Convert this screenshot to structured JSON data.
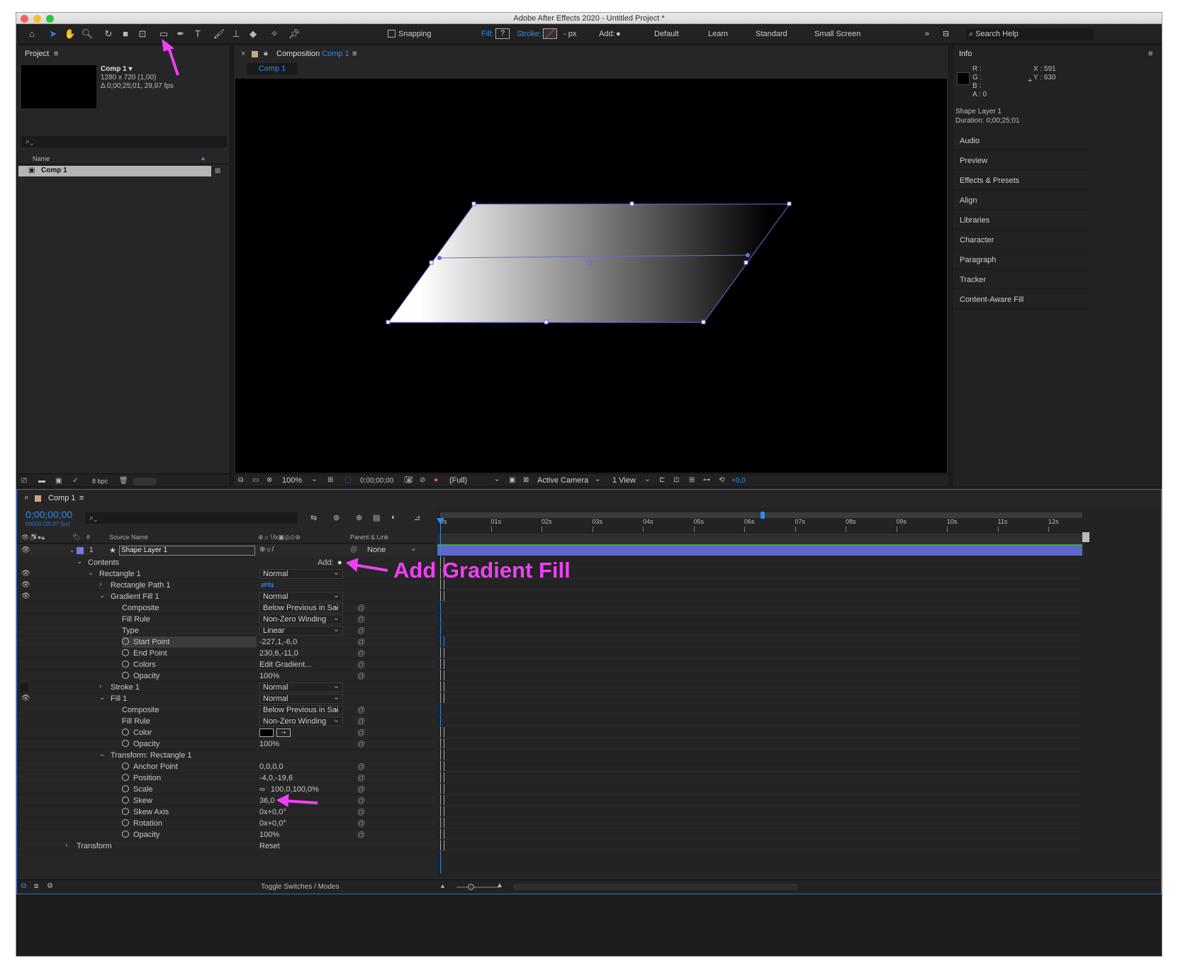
{
  "window": {
    "title": "Adobe After Effects 2020 - Untitled Project *"
  },
  "toolbar": {
    "snapping": "Snapping",
    "fill_label": "Fill:",
    "fill_value": "?",
    "stroke_label": "Stroke:",
    "px": "- px",
    "add": "Add:",
    "workspaces": [
      "Default",
      "Learn",
      "Standard",
      "Small Screen"
    ],
    "more": "»",
    "search_help": "Search Help"
  },
  "project": {
    "title": "Project",
    "comp_name": "Comp 1 ▾",
    "comp_size": "1280 x 720 (1,00)",
    "comp_duration": "Δ 0;00;25;01, 29,97 fps",
    "col_name": "Name",
    "item": "Comp 1",
    "bpc": "8 bpc"
  },
  "composition": {
    "title_prefix": "Composition",
    "title_comp": "Comp 1",
    "tab": "Comp 1",
    "zoom": "100%",
    "timecode": "0;00;00;00",
    "resolution": "(Full)",
    "camera": "Active Camera",
    "views": "1 View",
    "exposure": "+0,0"
  },
  "info": {
    "title": "Info",
    "r": "R :",
    "g": "G :",
    "b": "B :",
    "a": "A :  0",
    "x": "X : 591",
    "y": "Y :  630",
    "layer": "Shape Layer 1",
    "duration": "Duration: 0;00;25;01"
  },
  "right_panels": [
    "Audio",
    "Preview",
    "Effects & Presets",
    "Align",
    "Libraries",
    "Character",
    "Paragraph",
    "Tracker",
    "Content-Aware Fill"
  ],
  "timeline": {
    "title": "Comp 1",
    "timecode": "0;00;00;00",
    "fps": "00000 (29.97 fps)",
    "col_source": "Source Name",
    "col_parent": "Parent & Link",
    "layer_num": "1",
    "layer_name": "Shape Layer 1",
    "parent": "None",
    "ruler": [
      "0s",
      "01s",
      "02s",
      "03s",
      "04s",
      "05s",
      "06s",
      "07s",
      "08s",
      "09s",
      "10s",
      "11s",
      "12s"
    ],
    "toggle": "Toggle Switches / Modes"
  },
  "props": {
    "contents": "Contents",
    "add": "Add:",
    "rect1": "Rectangle 1",
    "rect1_mode": "Normal",
    "rect_path": "Rectangle Path 1",
    "grad": "Gradient Fill 1",
    "grad_mode": "Normal",
    "composite": "Composite",
    "composite_val": "Below Previous in Sai",
    "fill_rule": "Fill Rule",
    "fill_rule_val": "Non-Zero Winding",
    "type": "Type",
    "type_val": "Linear",
    "start": "Start Point",
    "start_val": "-227,1,-6,0",
    "end": "End Point",
    "end_val": "230,6,-11,0",
    "colors": "Colors",
    "colors_val": "Edit Gradient...",
    "opacity": "Opacity",
    "opacity_val": "100%",
    "stroke": "Stroke 1",
    "stroke_mode": "Normal",
    "fill": "Fill 1",
    "fill_mode": "Normal",
    "color": "Color",
    "transform_rect": "Transform: Rectangle 1",
    "anchor": "Anchor Point",
    "anchor_val": "0,0,0,0",
    "position": "Position",
    "position_val": "-4,0,-19,6",
    "scale": "Scale",
    "scale_val": "100,0,100,0%",
    "skew": "Skew",
    "skew_val": "36,0",
    "skew_axis": "Skew Axis",
    "skew_axis_val": "0x+0,0°",
    "rotation": "Rotation",
    "rotation_val": "0x+0,0°",
    "transform": "Transform",
    "reset": "Reset"
  },
  "annotation": {
    "text": "Add Gradient Fill",
    "color": "#f03ff5"
  }
}
